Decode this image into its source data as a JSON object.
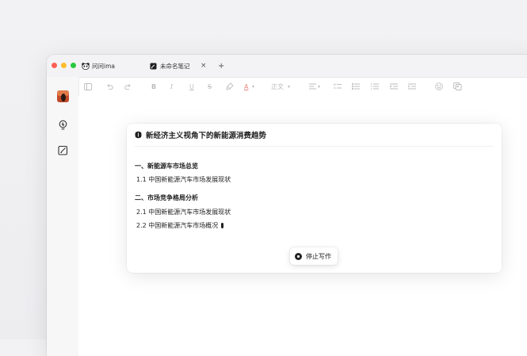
{
  "window": {
    "traffic_lights": [
      "#ff5f57",
      "#febc2e",
      "#28c840"
    ]
  },
  "tabs": [
    {
      "label": "问问ima",
      "icon": "panda-icon"
    },
    {
      "label": "未命名笔记",
      "icon": "note-icon"
    }
  ],
  "tab_close": "×",
  "tab_add": "+",
  "toolbar": {
    "bold": "B",
    "italic": "I",
    "underline": "U",
    "strike": "S",
    "font_color": "A",
    "paragraph_style": "正文"
  },
  "panel": {
    "title": "新经济主义视角下的新能源消费趋势",
    "lines": [
      {
        "text": "一、新能源车市场总览",
        "heading": true
      },
      {
        "text": "1.1 中国新能源汽车市场发展现状",
        "heading": false
      },
      {
        "text": "二、市场竞争格局分析",
        "heading": true
      },
      {
        "text": "2.1 中国新能源汽车市场发展现状",
        "heading": false
      },
      {
        "text": "2.2 中国新能源汽车市场概况",
        "heading": false
      }
    ],
    "stop_label": "停止写作"
  }
}
